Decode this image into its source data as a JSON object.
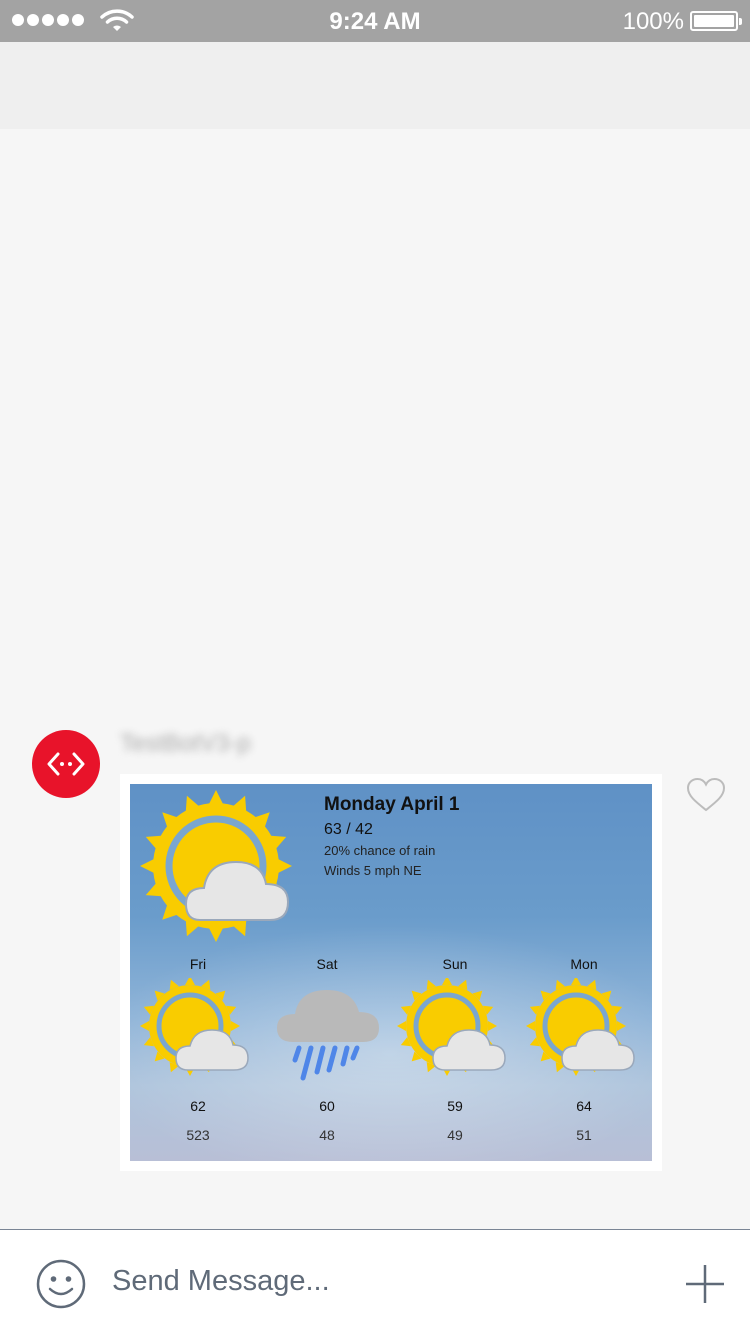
{
  "status_bar": {
    "time": "9:24 AM",
    "battery": "100%"
  },
  "message": {
    "sender": "TestBotV3-p",
    "card": {
      "today": {
        "date": "Monday April 1",
        "temps": "63 / 42",
        "rain": "20% chance of rain",
        "wind": "Winds 5 mph NE",
        "icon": "partly-cloudy-icon"
      },
      "forecast": [
        {
          "day": "Fri",
          "hi": "62",
          "lo": "523",
          "icon": "partly-cloudy-icon"
        },
        {
          "day": "Sat",
          "hi": "60",
          "lo": "48",
          "icon": "rain-icon"
        },
        {
          "day": "Sun",
          "hi": "59",
          "lo": "49",
          "icon": "partly-cloudy-icon"
        },
        {
          "day": "Mon",
          "hi": "64",
          "lo": "51",
          "icon": "partly-cloudy-icon"
        }
      ]
    }
  },
  "composer": {
    "placeholder": "Send Message..."
  },
  "colors": {
    "avatar": "#e8132a",
    "sun": "#f9cc00",
    "status_bar": "#a3a3a3"
  }
}
